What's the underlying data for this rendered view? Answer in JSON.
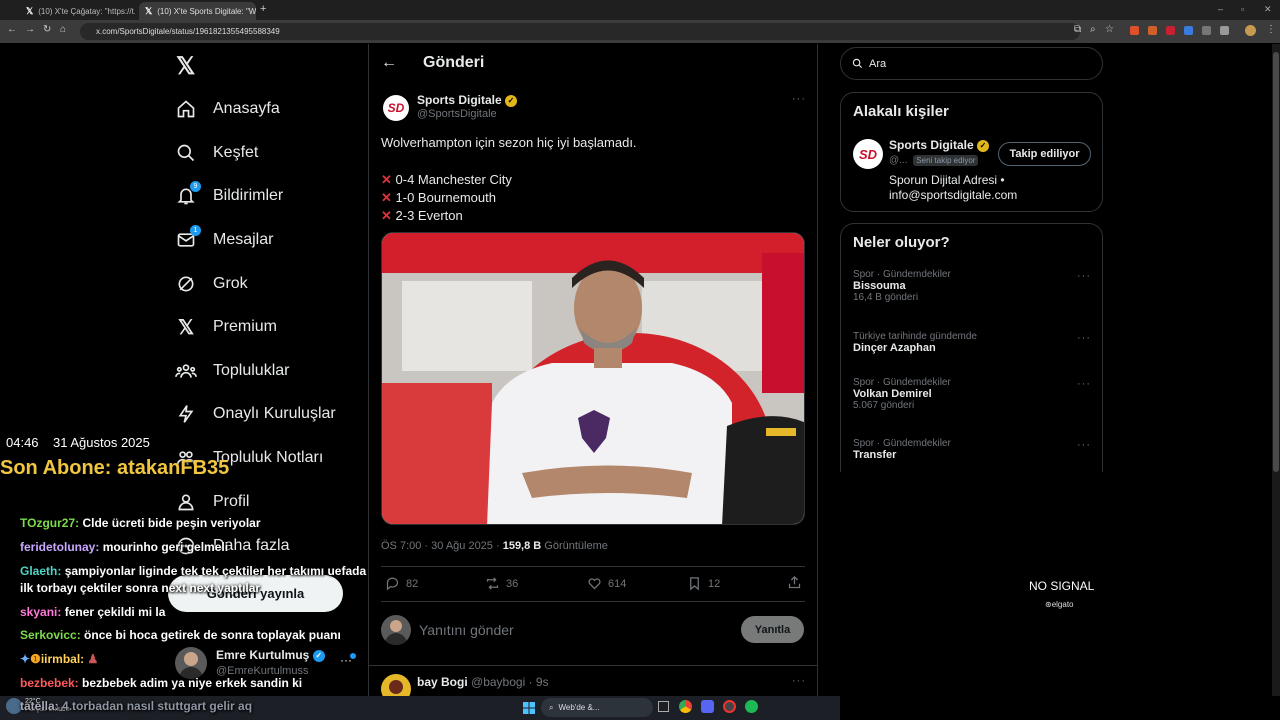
{
  "browser": {
    "tabs": [
      {
        "title": "(10) X'te Çağatay: \"https://t.co/..."
      },
      {
        "title": "(10) X'te Sports Digitale: \"Wolve..."
      }
    ],
    "url": "x.com/SportsDigitale/status/1961821355495588349"
  },
  "nav": {
    "items": [
      {
        "label": "Anasayfa",
        "icon": "home-icon"
      },
      {
        "label": "Keşfet",
        "icon": "search-icon"
      },
      {
        "label": "Bildirimler",
        "icon": "bell-icon",
        "badge": "9"
      },
      {
        "label": "Mesajlar",
        "icon": "mail-icon",
        "badge": "1"
      },
      {
        "label": "Grok",
        "icon": "grok-icon"
      },
      {
        "label": "Premium",
        "icon": "x-logo-icon"
      },
      {
        "label": "Topluluklar",
        "icon": "communities-icon"
      },
      {
        "label": "Onaylı Kuruluşlar",
        "icon": "lightning-icon"
      },
      {
        "label": "Topluluk Notları",
        "icon": "notes-icon"
      },
      {
        "label": "Profil",
        "icon": "profile-icon"
      },
      {
        "label": "Daha fazla",
        "icon": "more-circle-icon"
      }
    ],
    "post_button": "Gönderi yayınla",
    "account": {
      "name": "Emre Kurtulmuş",
      "handle": "@EmreKurtulmuss"
    }
  },
  "post": {
    "header": "Gönderi",
    "author": {
      "name": "Sports Digitale",
      "handle": "@SportsDigitale",
      "avatar_text": "SD"
    },
    "text": "Wolverhampton için sezon hiç iyi başlamadı.",
    "results": [
      "0-4 Manchester City",
      "1-0 Bournemouth",
      "2-3 Everton"
    ],
    "time": "ÖS 7:00 · 30 Ağu 2025 · ",
    "views": "159,8 B",
    "views_label": "Görüntüleme",
    "stats": {
      "replies": "82",
      "reposts": "36",
      "likes": "614",
      "bookmarks": "12"
    },
    "reply_placeholder": "Yanıtını gönder",
    "reply_button": "Yanıtla"
  },
  "reply": {
    "name": "bay Bogi",
    "handle": "@baybogi · 9s"
  },
  "right": {
    "search_placeholder": "Ara",
    "relevant_title": "Alakalı kişiler",
    "person": {
      "name": "Sports Digitale",
      "handle": "@...",
      "follows_you": "Seni takip ediyor",
      "follow_button": "Takip ediliyor",
      "bio1": "Sporun Dijital Adresi •",
      "bio2": "info@sportsdigitale.com"
    },
    "trends_title": "Neler oluyor?",
    "trends": [
      {
        "meta": "Spor · Gündemdekiler",
        "name": "Bissouma",
        "count": "16,4 B gönderi"
      },
      {
        "meta": "Türkiye tarihinde gündemde",
        "name": "Dinçer Azaphan",
        "count": ""
      },
      {
        "meta": "Spor · Gündemdekiler",
        "name": "Volkan Demirel",
        "count": "5.067 gönderi"
      },
      {
        "meta": "Spor · Gündemdekiler",
        "name": "Transfer",
        "count": ""
      }
    ]
  },
  "overlay": {
    "time": "04:46",
    "date": "31 Ağustos 2025",
    "sub": "Son Abone: atakanFB35",
    "no_signal": "NO SIGNAL",
    "elgato": "elgato",
    "chat": [
      {
        "user": "TOzgur27:",
        "msg": "Clde ücreti bide peşin veriyolar",
        "color": "#7bdc4a"
      },
      {
        "user": "feridetolunay:",
        "msg": "mourinho geri gelmeli",
        "color": "#c9a7ff"
      },
      {
        "user": "Glaeth:",
        "msg": "şampiyonlar liginde tek tek çektiler her takımı uefada",
        "color": "#4fd3c4"
      },
      {
        "user": "",
        "msg": "ilk torbayı çektiler sonra next next yaptılar",
        "color": "#fff"
      },
      {
        "user": "skyani:",
        "msg": "fener çekildi mi la",
        "color": "#ff7ad9"
      },
      {
        "user": "Serkovicc:",
        "msg": "önce bi hoca getirek de sonra toplayak puanı",
        "color": "#7bdc4a"
      },
      {
        "user": "iirmbal:",
        "msg": "",
        "color": "#ffd15a"
      },
      {
        "user": "bezbebek:",
        "msg": "bezbebek adim ya niye erkek sandin ki",
        "color": "#ff5a5a"
      },
      {
        "user": "tatella:",
        "msg": "4.torbadan nasıl stuttgart gelir aq",
        "color": "#aab"
      }
    ]
  },
  "taskbar": {
    "weather": "22°C",
    "weather_sub": "Parçalı bulutlu",
    "search": "Web'de &..."
  }
}
